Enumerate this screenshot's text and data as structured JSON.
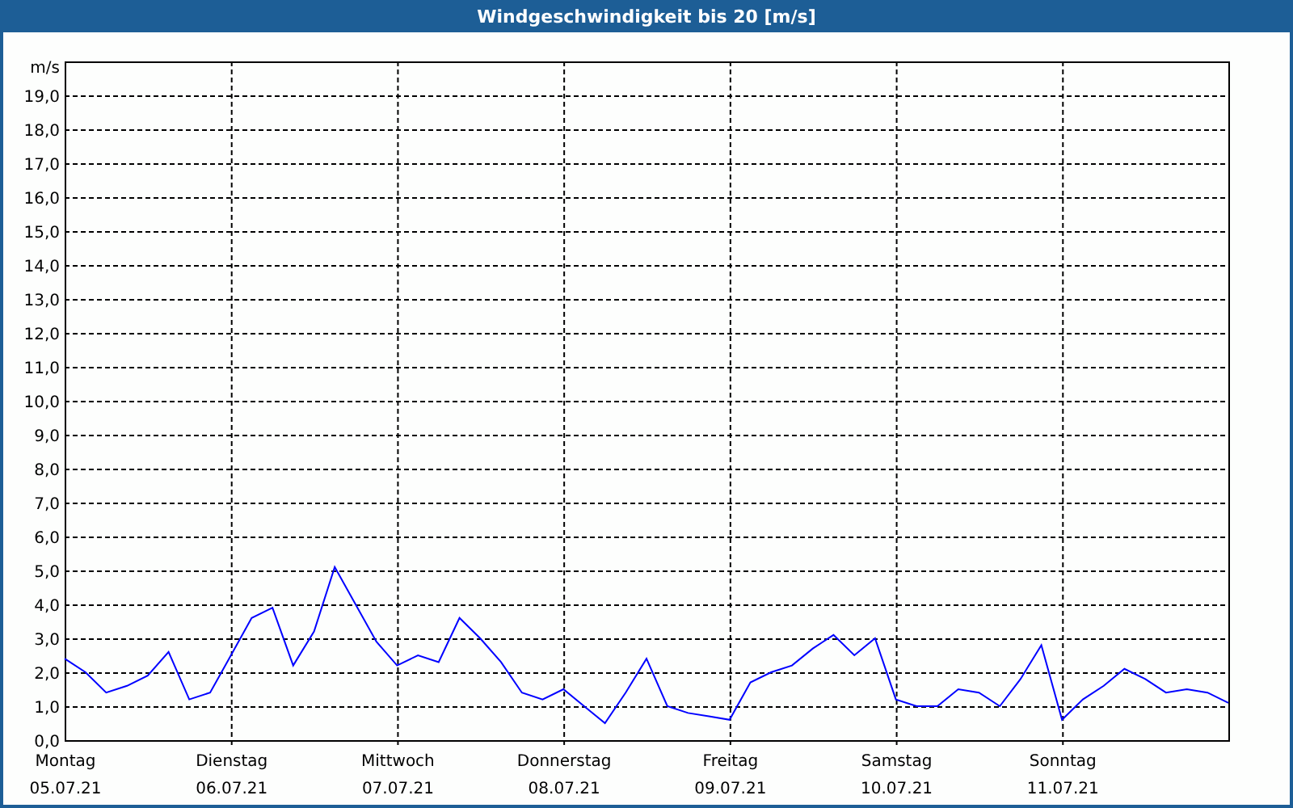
{
  "window": {
    "title": "Windgeschwindigkeit bis 20 [m/s]"
  },
  "chart": {
    "chart_data": {
      "type": "line",
      "ylabel": "m/s",
      "categories": [
        "Montag\n05.07.21",
        null,
        null,
        null,
        null,
        null,
        null,
        null,
        "Dienstag\n06.07.21",
        null,
        null,
        null,
        null,
        null,
        null,
        null,
        "Mittwoch\n07.07.21",
        null,
        null,
        null,
        null,
        null,
        null,
        null,
        "Donnerstag\n08.07.21",
        null,
        null,
        null,
        null,
        null,
        null,
        null,
        "Freitag\n09.07.21",
        null,
        null,
        null,
        null,
        null,
        null,
        null,
        "Samstag\n10.07.21",
        null,
        null,
        null,
        null,
        null,
        null,
        null,
        "Sonntag\n11.07.21",
        null,
        null,
        null,
        null,
        null,
        null,
        null,
        null
      ],
      "series": [
        {
          "color": "#0000ff",
          "values": [
            2.4,
            2.0,
            1.4,
            1.6,
            1.9,
            2.6,
            1.2,
            1.4,
            2.5,
            3.6,
            3.9,
            2.2,
            3.2,
            5.1,
            4.0,
            2.9,
            2.2,
            2.5,
            2.3,
            3.6,
            3.0,
            2.3,
            1.4,
            1.2,
            1.5,
            1.0,
            0.5,
            1.4,
            2.4,
            1.0,
            0.8,
            0.7,
            0.6,
            1.7,
            2.0,
            2.2,
            2.7,
            3.1,
            2.5,
            3.0,
            1.2,
            1.0,
            1.0,
            1.5,
            1.4,
            1.0,
            1.8,
            2.8,
            0.6,
            1.2,
            1.6,
            2.1,
            1.8,
            1.4,
            1.5,
            1.4,
            1.1
          ]
        }
      ],
      "ylim": [
        0,
        20
      ],
      "grid": true,
      "yticks": [
        {
          "value": 0,
          "label": "0,0"
        },
        {
          "value": 1,
          "label": "1,0"
        },
        {
          "value": 2,
          "label": "2,0"
        },
        {
          "value": 3,
          "label": "3,0"
        },
        {
          "value": 4,
          "label": "4,0"
        },
        {
          "value": 5,
          "label": "5,0"
        },
        {
          "value": 6,
          "label": "6,0"
        },
        {
          "value": 7,
          "label": "7,0"
        },
        {
          "value": 8,
          "label": "8,0"
        },
        {
          "value": 9,
          "label": "9,0"
        },
        {
          "value": 10,
          "label": "10,0"
        },
        {
          "value": 11,
          "label": "11,0"
        },
        {
          "value": 12,
          "label": "12,0"
        },
        {
          "value": 13,
          "label": "13,0"
        },
        {
          "value": 14,
          "label": "14,0"
        },
        {
          "value": 15,
          "label": "15,0"
        },
        {
          "value": 16,
          "label": "16,0"
        },
        {
          "value": 17,
          "label": "17,0"
        },
        {
          "value": 18,
          "label": "18,0"
        },
        {
          "value": 19,
          "label": "19,0"
        }
      ]
    }
  }
}
